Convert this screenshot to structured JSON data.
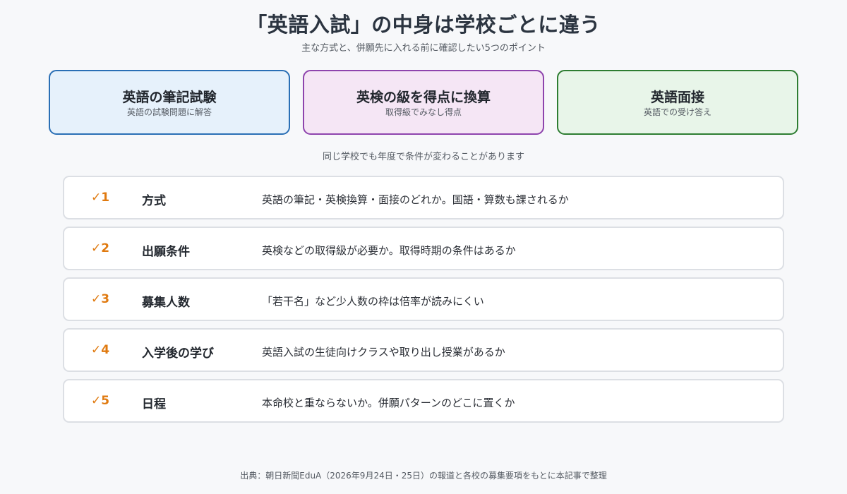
{
  "title": "「英語入試」の中身は学校ごとに違う",
  "subtitle": "主な方式と、併願先に入れる前に確認したい5つのポイント",
  "methods": [
    {
      "name": "英語の筆記試験",
      "desc": "英語の試験問題に解答",
      "border": "#2a6fb5",
      "fill": "#e6f1fb"
    },
    {
      "name": "英検の級を得点に換算",
      "desc": "取得級でみなし得点",
      "border": "#8e44ad",
      "fill": "#f5e6f5"
    },
    {
      "name": "英語面接",
      "desc": "英語での受け答え",
      "border": "#2e7d32",
      "fill": "#e8f5e9"
    }
  ],
  "note": "同じ学校でも年度で条件が変わることがあります",
  "checklist": [
    {
      "num": "✓1",
      "label": "方式",
      "detail": "英語の筆記・英検換算・面接のどれか。国語・算数も課されるか"
    },
    {
      "num": "✓2",
      "label": "出願条件",
      "detail": "英検などの取得級が必要か。取得時期の条件はあるか"
    },
    {
      "num": "✓3",
      "label": "募集人数",
      "detail": "「若干名」など少人数の枠は倍率が読みにくい"
    },
    {
      "num": "✓4",
      "label": "入学後の学び",
      "detail": "英語入試の生徒向けクラスや取り出し授業があるか"
    },
    {
      "num": "✓5",
      "label": "日程",
      "detail": "本命校と重ならないか。併願パターンのどこに置くか"
    }
  ],
  "source": "出典：朝日新聞EduA（2026年9月24日・25日）の報道と各校の募集要項をもとに本記事で整理",
  "colors": {
    "accent": "#e07a10",
    "row_border": "#dcdfe4",
    "background": "#f7f8fa"
  }
}
